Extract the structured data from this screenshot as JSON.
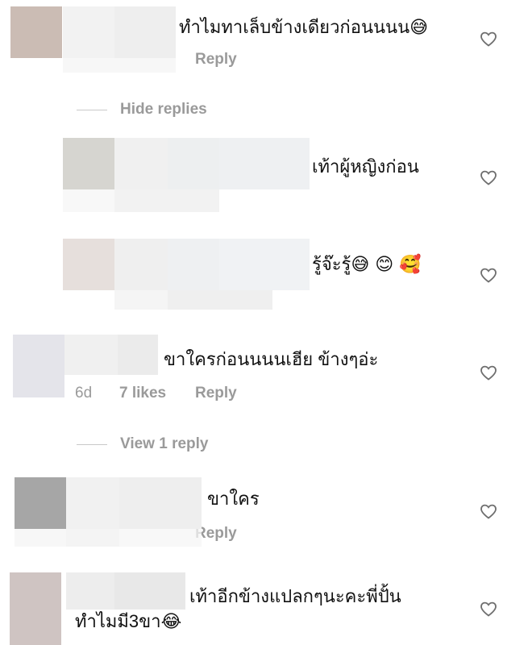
{
  "comments": [
    {
      "text": "ทำไมทาเล็บข้างเดียวก่อนนนน",
      "emoji": "😅",
      "reply_label": "Reply"
    },
    {
      "toggle_label": "Hide replies"
    },
    {
      "text": "เท้าผู้หญิงก่อน"
    },
    {
      "text": "รู้จ๊ะรู้",
      "emoji": "😅 😊 🥰"
    },
    {
      "text": "ขาใครก่อนนนนเฮีย ข้างๆอ่ะ",
      "age": "6d",
      "likes": "7 likes",
      "reply_label": "Reply"
    },
    {
      "toggle_label": "View 1 reply"
    },
    {
      "text": "ขาใคร",
      "reply_label": "Reply"
    },
    {
      "text_line1": "เท้าอีกข้างแปลกๆนะคะพี่ปั้น",
      "text_line2": "ทำไมมี3ขา",
      "emoji": "😂"
    }
  ],
  "icons": {
    "like": "heart-outline-icon"
  },
  "colors": {
    "meta": "#9a9a9a",
    "divider": "#c9c9c9",
    "heart": "#6e6e6e"
  }
}
